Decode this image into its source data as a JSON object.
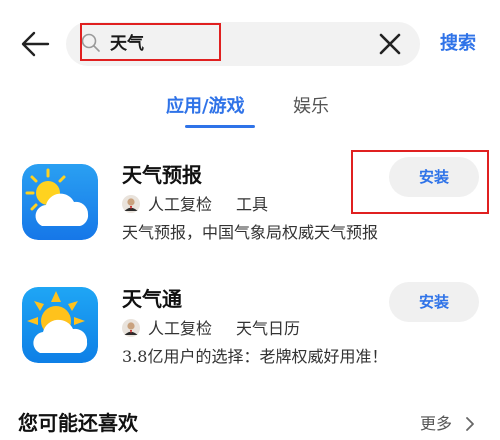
{
  "search": {
    "query": "天气",
    "search_button_label": "搜索",
    "highlight_color": "#e02020"
  },
  "tabs": [
    {
      "label": "应用/游戏",
      "active": true
    },
    {
      "label": "娱乐",
      "active": false
    }
  ],
  "results": [
    {
      "name": "天气预报",
      "verified_label": "人工复检",
      "category": "工具",
      "description": "天气预报，中国气象局权威天气预报",
      "install_label": "安装",
      "icon": "sun-cloud-icon"
    },
    {
      "name": "天气通",
      "verified_label": "人工复检",
      "category": "天气日历",
      "description": "3.8亿用户的选择：老牌权威好用准！",
      "install_label": "安装",
      "icon": "sun-cloud-icon"
    }
  ],
  "recommend": {
    "title": "您可能还喜欢",
    "more_label": "更多"
  },
  "colors": {
    "accent": "#2f73e8",
    "annotation": "#e02020"
  }
}
